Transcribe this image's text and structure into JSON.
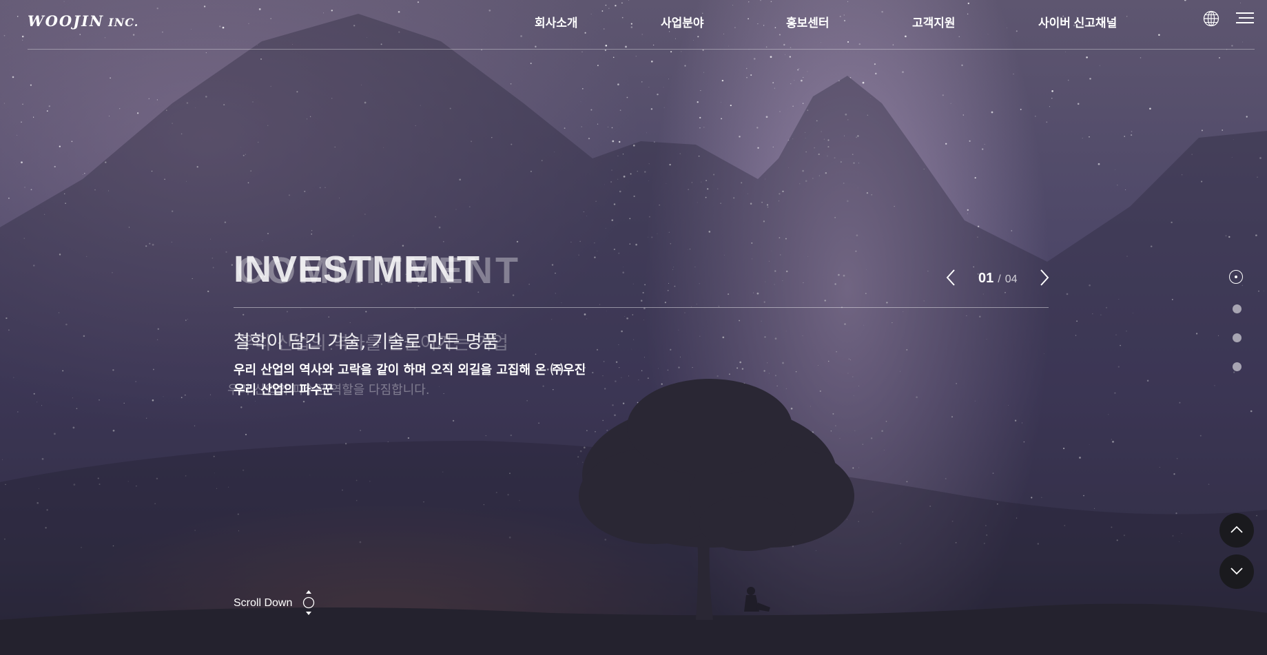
{
  "header": {
    "logo_main": "WOOJIN",
    "logo_suffix": "INC.",
    "nav": [
      {
        "label": "회사소개"
      },
      {
        "label": "사업분야"
      },
      {
        "label": "홍보센터"
      },
      {
        "label": "고객지원"
      },
      {
        "label": "사이버 신고채널"
      }
    ],
    "icons": [
      "globe-icon",
      "hamburger-menu-icon"
    ]
  },
  "hero": {
    "title": "INVESTMENT",
    "title_ghost": "COMMITMENT",
    "subtitle": "철학이 담긴 기술, 기술로 만든 명품",
    "subtitle_ghost": "우리 산업의 역사를 만들어가는 기업",
    "description_line1": "우리 산업의 역사와 고락을 같이 하며 오직 외길을 고집해 온 ㈜우진",
    "description_line2": "우리 산업의 파수꾼",
    "description_ghost": "우리 산업의 파수꾼 역할을 다짐합니다."
  },
  "slider": {
    "current": "01",
    "separator": "/",
    "total": "04",
    "icons": [
      "chevron-left-icon",
      "chevron-right-icon"
    ]
  },
  "pagination": {
    "count": 4,
    "active_index": 0
  },
  "scroll": {
    "label": "Scroll Down"
  },
  "floating_buttons": {
    "icons": [
      "chevron-up-icon",
      "chevron-down-icon"
    ],
    "color": "#1a1a1e"
  }
}
